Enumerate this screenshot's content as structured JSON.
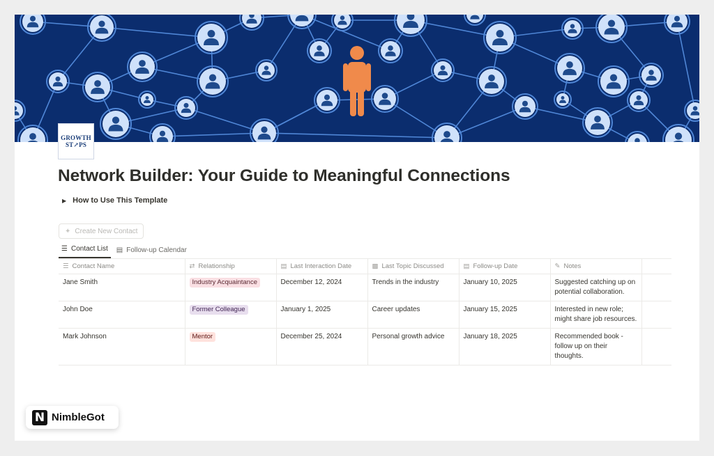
{
  "logo": {
    "line1": "GROWTH",
    "line2": "ST↗PS"
  },
  "page": {
    "title": "Network Builder: Your Guide to Meaningful Connections"
  },
  "toggle": {
    "icon": "triangle-right-icon",
    "label": "How to Use This Template"
  },
  "create_button": {
    "icon": "sparkle-icon",
    "label": "Create New Contact"
  },
  "tabs": [
    {
      "icon": "list-icon",
      "label": "Contact List",
      "active": true
    },
    {
      "icon": "calendar-icon",
      "label": "Follow-up Calendar",
      "active": false
    }
  ],
  "columns": [
    {
      "icon": "text-icon",
      "label": "Contact Name"
    },
    {
      "icon": "relation-icon",
      "label": "Relationship"
    },
    {
      "icon": "calendar-icon",
      "label": "Last Interaction Date"
    },
    {
      "icon": "chat-icon",
      "label": "Last Topic Discussed"
    },
    {
      "icon": "calendar-icon",
      "label": "Follow-up Date"
    },
    {
      "icon": "edit-note-icon",
      "label": "Notes"
    }
  ],
  "rows": [
    {
      "name": "Jane Smith",
      "relationship": "Industry Acquaintance",
      "rel_bg": "#fadfe3",
      "rel_fg": "#5a2a33",
      "last_date": "December 12, 2024",
      "topic": "Trends in the industry",
      "follow_up": "January 10, 2025",
      "notes": "Suggested catching up on potential collaboration."
    },
    {
      "name": "John Doe",
      "relationship": "Former Colleague",
      "rel_bg": "#e8deee",
      "rel_fg": "#412454",
      "last_date": "January 1, 2025",
      "topic": "Career updates",
      "follow_up": "January 15, 2025",
      "notes": "Interested in new role; might share job resources."
    },
    {
      "name": "Mark Johnson",
      "relationship": "Mentor",
      "rel_bg": "#ffe2dd",
      "rel_fg": "#5d1715",
      "last_date": "December 25, 2024",
      "topic": "Personal growth advice",
      "follow_up": "January 18, 2025",
      "notes": "Recommended book - follow up on their thoughts."
    }
  ],
  "brand": {
    "mark": "N",
    "name": "NimbleGot"
  },
  "colors": {
    "banner_bg": "#0b2d6e",
    "network_line": "#4f86d6",
    "node_fill": "#cfe1fa",
    "person_icon": "#1e4a8c",
    "center_person": "#f08a4b"
  }
}
